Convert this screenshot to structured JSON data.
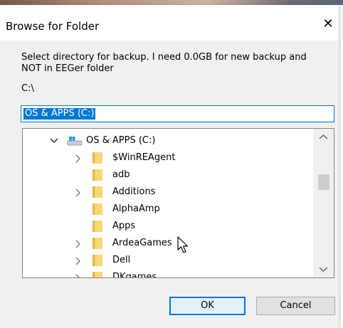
{
  "dialog": {
    "title": "Browse for Folder",
    "close_glyph": "✕",
    "description": "Select directory for backup. I need 0.0GB for new backup and NOT in EEGer folder",
    "current_path": "C:\\",
    "folder_input_value": "OS & APPS (C:)"
  },
  "tree": {
    "root": {
      "label": "OS & APPS (C:)",
      "expanded": true,
      "icon": "drive-icon"
    },
    "items": [
      {
        "label": "$WinREAgent",
        "has_children": true
      },
      {
        "label": "adb",
        "has_children": false
      },
      {
        "label": "Additions",
        "has_children": true
      },
      {
        "label": "AlphaAmp",
        "has_children": false
      },
      {
        "label": "Apps",
        "has_children": false
      },
      {
        "label": "ArdeaGames",
        "has_children": true
      },
      {
        "label": "Dell",
        "has_children": true
      },
      {
        "label": "DKgames",
        "has_children": true
      }
    ]
  },
  "buttons": {
    "ok_label": "OK",
    "cancel_label": "Cancel"
  },
  "colors": {
    "accent": "#0078d7",
    "folder": "#f8d775",
    "dialog_bg": "#f0f0f0"
  }
}
